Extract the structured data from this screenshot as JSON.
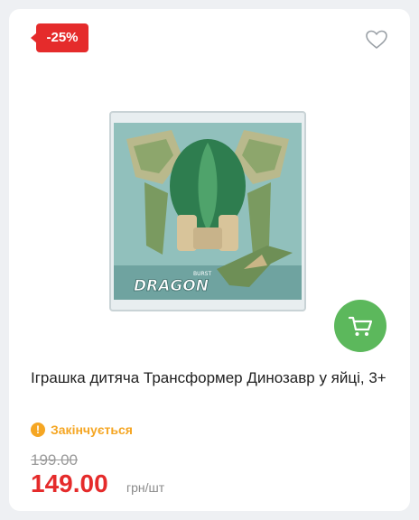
{
  "product": {
    "discount_label": "-25%",
    "title": "Іграшка дитяча Трансформер Динозавр у яйці, 3+",
    "stock_status": "Закінчується",
    "old_price": "199.00",
    "current_price": "149.00",
    "price_unit": "грн/шт",
    "image_brand_text": "DRAGON",
    "image_brand_subtext": "BURST"
  },
  "icons": {
    "favorite": "heart-outline-icon",
    "cart": "cart-icon",
    "stock_warning": "exclamation-circle-icon"
  },
  "colors": {
    "discount": "#e52b2b",
    "cart_button": "#5cb85c",
    "stock_warning": "#f5a623",
    "price": "#e52b2b",
    "old_price": "#9a9a9a"
  }
}
